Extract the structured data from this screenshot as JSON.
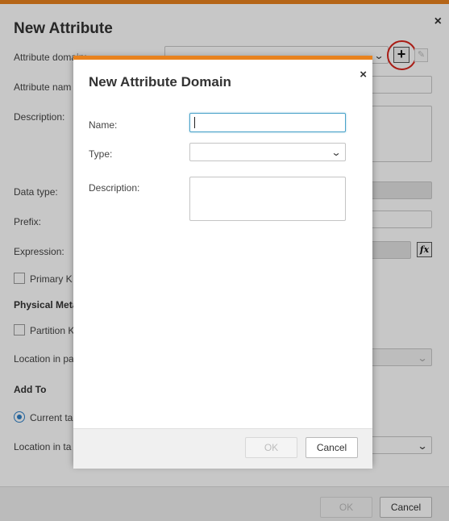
{
  "attribute_dialog": {
    "title": "New Attribute",
    "labels": {
      "attribute_domain": "Attribute domain:",
      "attribute_name": "Attribute nam",
      "description": "Description:",
      "data_type": "Data type:",
      "prefix": "Prefix:",
      "expression": "Expression:",
      "primary_key": "Primary K",
      "location_in_partition": "Location in pa",
      "current_table": "Current ta",
      "location_in_table": "Location in ta"
    },
    "sections": {
      "physical_metadata": "Physical Meta",
      "add_to": "Add To",
      "partition_key": "Partition K"
    },
    "buttons": {
      "add": "+",
      "edit": "✎",
      "fx": "fx",
      "ok": "OK",
      "cancel": "Cancel",
      "close": "×"
    }
  },
  "domain_dialog": {
    "title": "New Attribute Domain",
    "close": "×",
    "fields": {
      "name_label": "Name:",
      "name_value": "",
      "type_label": "Type:",
      "type_value": "",
      "description_label": "Description:",
      "description_value": ""
    },
    "buttons": {
      "ok": "OK",
      "cancel": "Cancel"
    }
  },
  "colors": {
    "accent": "#e8821e",
    "highlight_ring": "#d9251c",
    "focus": "#4aa3c9",
    "radio": "#2f80c8"
  }
}
